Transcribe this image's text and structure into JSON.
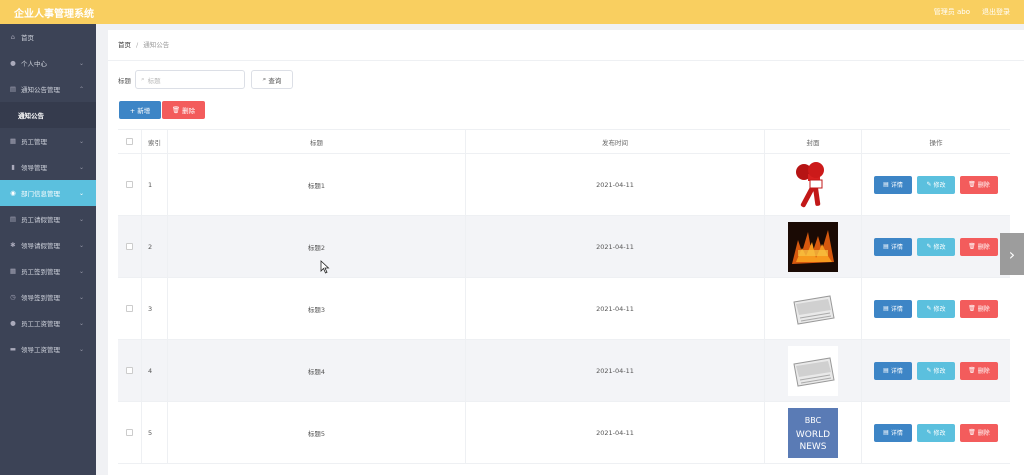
{
  "header": {
    "title": "企业人事管理系统",
    "user_label": "管理员 abo",
    "logout_label": "退出登录"
  },
  "sidebar": {
    "items": [
      {
        "label": "首页",
        "icon": "home-icon",
        "glyph": "⌂",
        "chev": ""
      },
      {
        "label": "个人中心",
        "icon": "user-icon",
        "glyph": "●",
        "chev": "⌄"
      },
      {
        "label": "通知公告管理",
        "icon": "list-icon",
        "glyph": "▤",
        "chev": "⌃"
      },
      {
        "label": "员工管理",
        "icon": "doc-icon",
        "glyph": "▦",
        "chev": "⌄"
      },
      {
        "label": "领导管理",
        "icon": "chart-icon",
        "glyph": "▮",
        "chev": "⌄"
      },
      {
        "label": "部门信息管理",
        "icon": "settings-icon",
        "glyph": "◉",
        "chev": "⌄"
      },
      {
        "label": "员工请假管理",
        "icon": "doc2-icon",
        "glyph": "▤",
        "chev": "⌄"
      },
      {
        "label": "领导请假管理",
        "icon": "gear-icon",
        "glyph": "✱",
        "chev": "⌄"
      },
      {
        "label": "员工签到管理",
        "icon": "grid-icon",
        "glyph": "▦",
        "chev": "⌄"
      },
      {
        "label": "领导签到管理",
        "icon": "clock-icon",
        "glyph": "◷",
        "chev": "⌄"
      },
      {
        "label": "员工工资管理",
        "icon": "person-icon",
        "glyph": "●",
        "chev": "⌄"
      },
      {
        "label": "领导工资管理",
        "icon": "wallet-icon",
        "glyph": "▬",
        "chev": "⌄"
      }
    ],
    "sub_item": "通知公告"
  },
  "breadcrumb": {
    "home": "首页",
    "sep": "/",
    "current": "通知公告"
  },
  "search": {
    "label": "标题",
    "placeholder": "标题",
    "button": "查询"
  },
  "actions": {
    "add": "+ 新增",
    "delete": "删除"
  },
  "table": {
    "headers": {
      "index": "索引",
      "title": "标题",
      "date": "发布时间",
      "cover": "封面",
      "ops": "操作"
    },
    "ops": {
      "detail": "详情",
      "edit": "修改",
      "delete": "删除"
    },
    "rows": [
      {
        "index": "1",
        "title": "标题1",
        "date": "2021-04-11",
        "cover": "microphone-image"
      },
      {
        "index": "2",
        "title": "标题2",
        "date": "2021-04-11",
        "cover": "fire-text-image"
      },
      {
        "index": "3",
        "title": "标题3",
        "date": "2021-04-11",
        "cover": "news-paper-image"
      },
      {
        "index": "4",
        "title": "标题4",
        "date": "2021-04-11",
        "cover": "news-paper-image"
      },
      {
        "index": "5",
        "title": "标题5",
        "date": "2021-04-11",
        "cover": "bbc-world-news-image",
        "cover_text": [
          "BBC",
          "WORLD",
          "NEWS"
        ]
      }
    ]
  },
  "colors": {
    "topbar": "#f9cf60",
    "sidebar": "#3c4356",
    "active": "#5bc0de",
    "primary": "#3d85c6",
    "danger": "#f35c5c"
  }
}
